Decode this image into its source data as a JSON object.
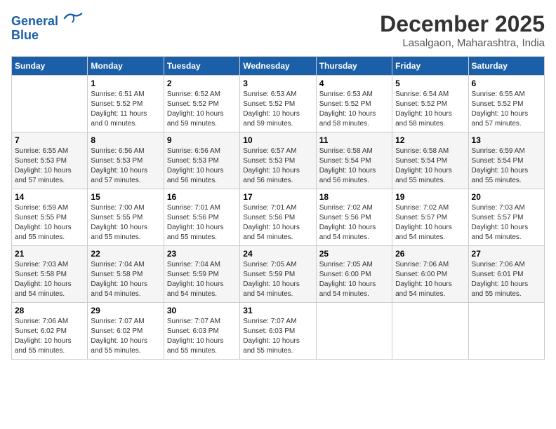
{
  "header": {
    "logo_line1": "General",
    "logo_line2": "Blue",
    "month_title": "December 2025",
    "location": "Lasalgaon, Maharashtra, India"
  },
  "weekdays": [
    "Sunday",
    "Monday",
    "Tuesday",
    "Wednesday",
    "Thursday",
    "Friday",
    "Saturday"
  ],
  "weeks": [
    [
      {
        "day": "",
        "info": ""
      },
      {
        "day": "1",
        "info": "Sunrise: 6:51 AM\nSunset: 5:52 PM\nDaylight: 11 hours\nand 0 minutes."
      },
      {
        "day": "2",
        "info": "Sunrise: 6:52 AM\nSunset: 5:52 PM\nDaylight: 10 hours\nand 59 minutes."
      },
      {
        "day": "3",
        "info": "Sunrise: 6:53 AM\nSunset: 5:52 PM\nDaylight: 10 hours\nand 59 minutes."
      },
      {
        "day": "4",
        "info": "Sunrise: 6:53 AM\nSunset: 5:52 PM\nDaylight: 10 hours\nand 58 minutes."
      },
      {
        "day": "5",
        "info": "Sunrise: 6:54 AM\nSunset: 5:52 PM\nDaylight: 10 hours\nand 58 minutes."
      },
      {
        "day": "6",
        "info": "Sunrise: 6:55 AM\nSunset: 5:52 PM\nDaylight: 10 hours\nand 57 minutes."
      }
    ],
    [
      {
        "day": "7",
        "info": "Sunrise: 6:55 AM\nSunset: 5:53 PM\nDaylight: 10 hours\nand 57 minutes."
      },
      {
        "day": "8",
        "info": "Sunrise: 6:56 AM\nSunset: 5:53 PM\nDaylight: 10 hours\nand 57 minutes."
      },
      {
        "day": "9",
        "info": "Sunrise: 6:56 AM\nSunset: 5:53 PM\nDaylight: 10 hours\nand 56 minutes."
      },
      {
        "day": "10",
        "info": "Sunrise: 6:57 AM\nSunset: 5:53 PM\nDaylight: 10 hours\nand 56 minutes."
      },
      {
        "day": "11",
        "info": "Sunrise: 6:58 AM\nSunset: 5:54 PM\nDaylight: 10 hours\nand 56 minutes."
      },
      {
        "day": "12",
        "info": "Sunrise: 6:58 AM\nSunset: 5:54 PM\nDaylight: 10 hours\nand 55 minutes."
      },
      {
        "day": "13",
        "info": "Sunrise: 6:59 AM\nSunset: 5:54 PM\nDaylight: 10 hours\nand 55 minutes."
      }
    ],
    [
      {
        "day": "14",
        "info": "Sunrise: 6:59 AM\nSunset: 5:55 PM\nDaylight: 10 hours\nand 55 minutes."
      },
      {
        "day": "15",
        "info": "Sunrise: 7:00 AM\nSunset: 5:55 PM\nDaylight: 10 hours\nand 55 minutes."
      },
      {
        "day": "16",
        "info": "Sunrise: 7:01 AM\nSunset: 5:56 PM\nDaylight: 10 hours\nand 55 minutes."
      },
      {
        "day": "17",
        "info": "Sunrise: 7:01 AM\nSunset: 5:56 PM\nDaylight: 10 hours\nand 54 minutes."
      },
      {
        "day": "18",
        "info": "Sunrise: 7:02 AM\nSunset: 5:56 PM\nDaylight: 10 hours\nand 54 minutes."
      },
      {
        "day": "19",
        "info": "Sunrise: 7:02 AM\nSunset: 5:57 PM\nDaylight: 10 hours\nand 54 minutes."
      },
      {
        "day": "20",
        "info": "Sunrise: 7:03 AM\nSunset: 5:57 PM\nDaylight: 10 hours\nand 54 minutes."
      }
    ],
    [
      {
        "day": "21",
        "info": "Sunrise: 7:03 AM\nSunset: 5:58 PM\nDaylight: 10 hours\nand 54 minutes."
      },
      {
        "day": "22",
        "info": "Sunrise: 7:04 AM\nSunset: 5:58 PM\nDaylight: 10 hours\nand 54 minutes."
      },
      {
        "day": "23",
        "info": "Sunrise: 7:04 AM\nSunset: 5:59 PM\nDaylight: 10 hours\nand 54 minutes."
      },
      {
        "day": "24",
        "info": "Sunrise: 7:05 AM\nSunset: 5:59 PM\nDaylight: 10 hours\nand 54 minutes."
      },
      {
        "day": "25",
        "info": "Sunrise: 7:05 AM\nSunset: 6:00 PM\nDaylight: 10 hours\nand 54 minutes."
      },
      {
        "day": "26",
        "info": "Sunrise: 7:06 AM\nSunset: 6:00 PM\nDaylight: 10 hours\nand 54 minutes."
      },
      {
        "day": "27",
        "info": "Sunrise: 7:06 AM\nSunset: 6:01 PM\nDaylight: 10 hours\nand 55 minutes."
      }
    ],
    [
      {
        "day": "28",
        "info": "Sunrise: 7:06 AM\nSunset: 6:02 PM\nDaylight: 10 hours\nand 55 minutes."
      },
      {
        "day": "29",
        "info": "Sunrise: 7:07 AM\nSunset: 6:02 PM\nDaylight: 10 hours\nand 55 minutes."
      },
      {
        "day": "30",
        "info": "Sunrise: 7:07 AM\nSunset: 6:03 PM\nDaylight: 10 hours\nand 55 minutes."
      },
      {
        "day": "31",
        "info": "Sunrise: 7:07 AM\nSunset: 6:03 PM\nDaylight: 10 hours\nand 55 minutes."
      },
      {
        "day": "",
        "info": ""
      },
      {
        "day": "",
        "info": ""
      },
      {
        "day": "",
        "info": ""
      }
    ]
  ]
}
